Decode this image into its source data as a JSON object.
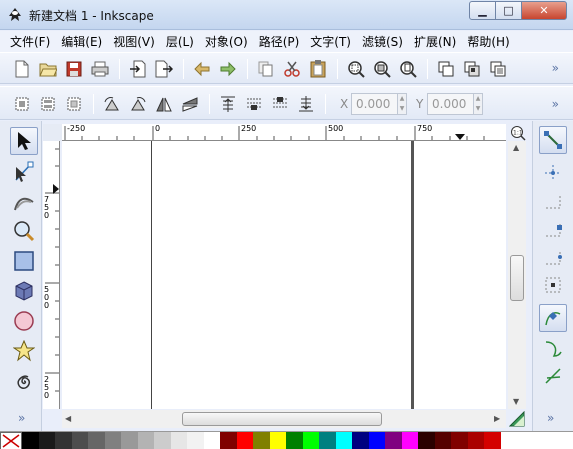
{
  "window": {
    "title": "新建文档 1 - Inkscape",
    "minimize_label": "▁",
    "maximize_label": "□",
    "close_label": "✕"
  },
  "menubar": {
    "items": [
      {
        "label": "文件(F)"
      },
      {
        "label": "编辑(E)"
      },
      {
        "label": "视图(V)"
      },
      {
        "label": "层(L)"
      },
      {
        "label": "对象(O)"
      },
      {
        "label": "路径(P)"
      },
      {
        "label": "文字(T)"
      },
      {
        "label": "滤镜(S)"
      },
      {
        "label": "扩展(N)"
      },
      {
        "label": "帮助(H)"
      }
    ]
  },
  "toolbar_commands": {
    "more_label": "»",
    "icons": [
      "new-document-icon",
      "open-icon",
      "save-icon",
      "print-icon",
      "import-icon",
      "export-icon",
      "undo-icon",
      "redo-icon",
      "copy-icon",
      "cut-icon",
      "paste-icon",
      "zoom-selection-icon",
      "zoom-drawing-icon",
      "zoom-page-icon",
      "duplicate-icon",
      "clone-icon",
      "unlink-clone-icon"
    ]
  },
  "toolbar_select": {
    "more_label": "»",
    "x_label": "X",
    "x_value": "0.000",
    "y_label": "Y",
    "y_value": "0.000"
  },
  "rulers": {
    "h_ticks": [
      "-250",
      "0",
      "250",
      "500",
      "750"
    ],
    "v_ticks": [
      "7\n5\n0",
      "5\n0\n0",
      "2\n5\n0"
    ]
  },
  "tools": [
    "selector-tool",
    "node-tool",
    "tweak-tool",
    "zoom-tool",
    "rectangle-tool",
    "3d-box-tool",
    "ellipse-tool",
    "star-tool",
    "spiral-tool"
  ],
  "left_more_label": "»",
  "right_more_label": "»",
  "snap_tools": [
    "snap-toggle",
    "snap-bbox",
    "snap-bbox-edge",
    "snap-bbox-corner",
    "snap-bbox-midpoint",
    "snap-bbox-center",
    "snap-nodes",
    "snap-paths",
    "snap-intersections"
  ],
  "palette": {
    "colors": [
      "#000000",
      "#1a1a1a",
      "#333333",
      "#4d4d4d",
      "#666666",
      "#808080",
      "#999999",
      "#b3b3b3",
      "#cccccc",
      "#e6e6e6",
      "#f2f2f2",
      "#ffffff",
      "#800000",
      "#ff0000",
      "#808000",
      "#ffff00",
      "#008000",
      "#00ff00",
      "#008080",
      "#00ffff",
      "#000080",
      "#0000ff",
      "#800080",
      "#ff00ff",
      "#2b0000",
      "#550000",
      "#800000",
      "#aa0000",
      "#d40000"
    ]
  }
}
